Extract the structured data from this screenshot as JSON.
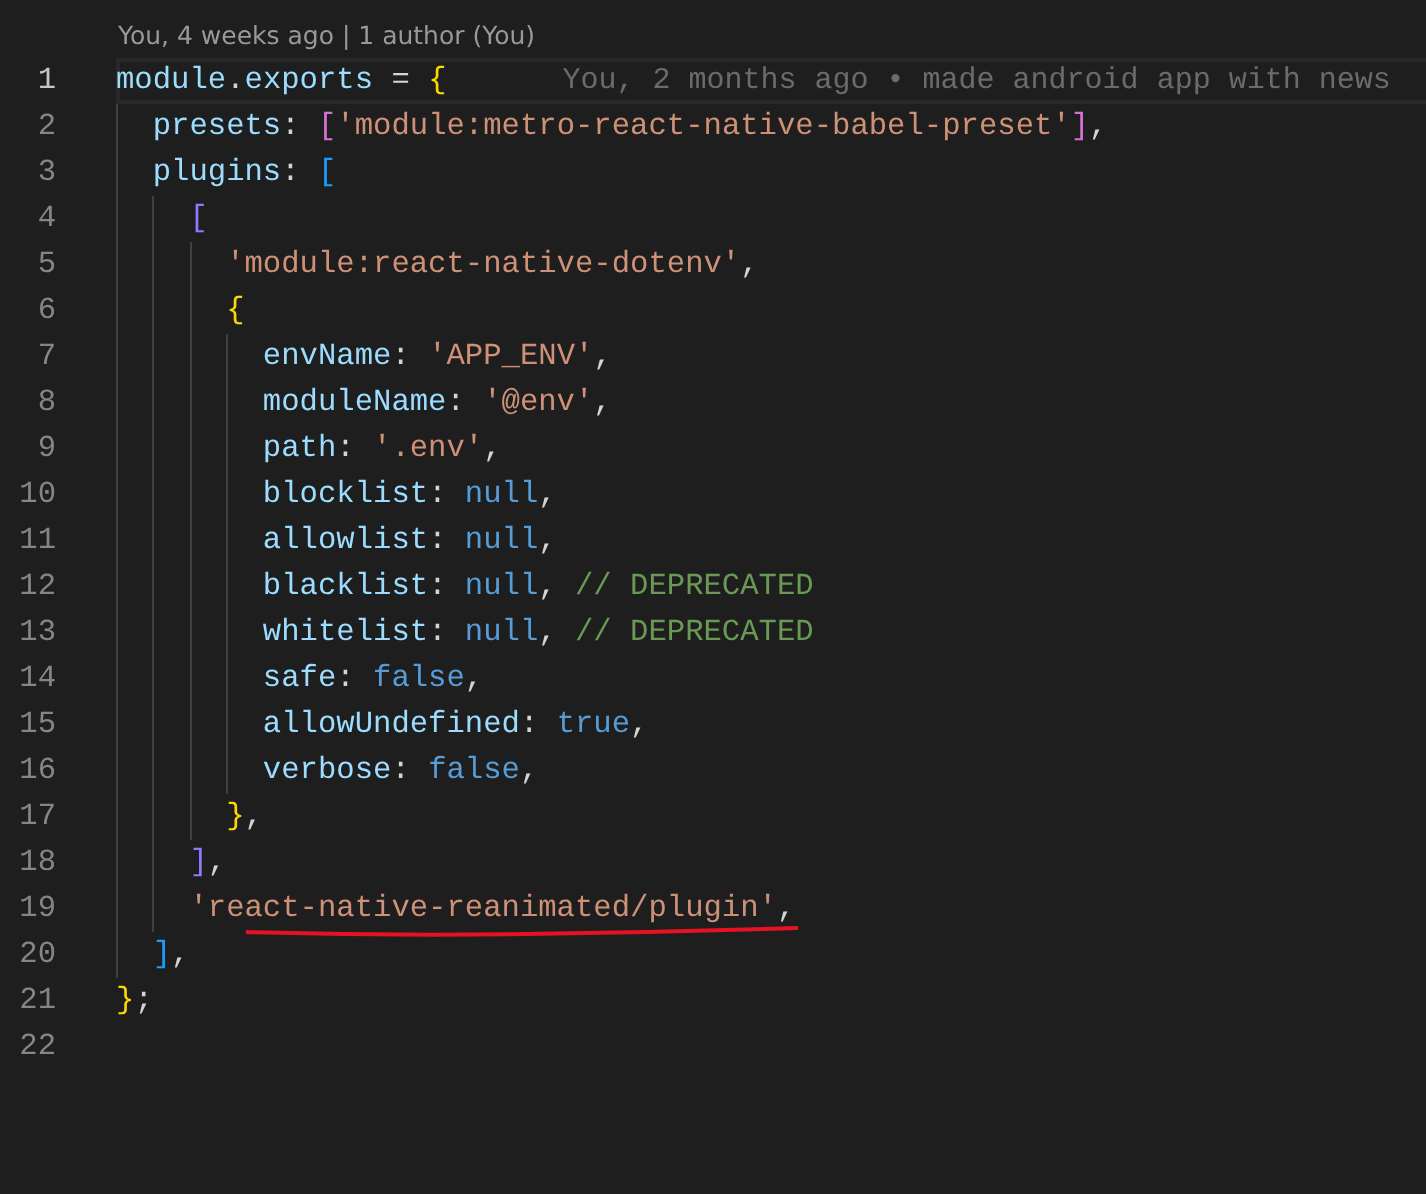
{
  "codelens": "You, 4 weeks ago | 1 author (You)",
  "lines": [
    {
      "number": "1",
      "current": true,
      "underlined": false,
      "blame": "You, 2 months ago • made android app with news",
      "tokens": [
        {
          "text": "module",
          "kind": "prop"
        },
        {
          "text": ".",
          "kind": "plain"
        },
        {
          "text": "exports",
          "kind": "prop"
        },
        {
          "text": " = ",
          "kind": "plain"
        },
        {
          "text": "{",
          "kind": "bracket1"
        }
      ]
    },
    {
      "number": "2",
      "current": false,
      "underlined": false,
      "tokens": [
        {
          "text": "  presets",
          "kind": "prop"
        },
        {
          "text": ": ",
          "kind": "plain"
        },
        {
          "text": "[",
          "kind": "bracket2"
        },
        {
          "text": "'module:metro-react-native-babel-preset'",
          "kind": "string"
        },
        {
          "text": "]",
          "kind": "bracket2"
        },
        {
          "text": ",",
          "kind": "plain"
        }
      ]
    },
    {
      "number": "3",
      "current": false,
      "underlined": false,
      "tokens": [
        {
          "text": "  plugins",
          "kind": "prop"
        },
        {
          "text": ": ",
          "kind": "plain"
        },
        {
          "text": "[",
          "kind": "bracket3"
        }
      ]
    },
    {
      "number": "4",
      "current": false,
      "underlined": false,
      "tokens": [
        {
          "text": "    [",
          "kind": "bracket4"
        }
      ]
    },
    {
      "number": "5",
      "current": false,
      "underlined": false,
      "tokens": [
        {
          "text": "      'module:react-native-dotenv'",
          "kind": "string"
        },
        {
          "text": ",",
          "kind": "plain"
        }
      ]
    },
    {
      "number": "6",
      "current": false,
      "underlined": false,
      "tokens": [
        {
          "text": "      {",
          "kind": "bracket1"
        }
      ]
    },
    {
      "number": "7",
      "current": false,
      "underlined": false,
      "tokens": [
        {
          "text": "        envName",
          "kind": "prop"
        },
        {
          "text": ": ",
          "kind": "plain"
        },
        {
          "text": "'APP_ENV'",
          "kind": "string"
        },
        {
          "text": ",",
          "kind": "plain"
        }
      ]
    },
    {
      "number": "8",
      "current": false,
      "underlined": false,
      "tokens": [
        {
          "text": "        moduleName",
          "kind": "prop"
        },
        {
          "text": ": ",
          "kind": "plain"
        },
        {
          "text": "'@env'",
          "kind": "string"
        },
        {
          "text": ",",
          "kind": "plain"
        }
      ]
    },
    {
      "number": "9",
      "current": false,
      "underlined": false,
      "tokens": [
        {
          "text": "        path",
          "kind": "prop"
        },
        {
          "text": ": ",
          "kind": "plain"
        },
        {
          "text": "'.env'",
          "kind": "string"
        },
        {
          "text": ",",
          "kind": "plain"
        }
      ]
    },
    {
      "number": "10",
      "current": false,
      "underlined": false,
      "tokens": [
        {
          "text": "        blocklist",
          "kind": "prop"
        },
        {
          "text": ": ",
          "kind": "plain"
        },
        {
          "text": "null",
          "kind": "constant"
        },
        {
          "text": ",",
          "kind": "plain"
        }
      ]
    },
    {
      "number": "11",
      "current": false,
      "underlined": false,
      "tokens": [
        {
          "text": "        allowlist",
          "kind": "prop"
        },
        {
          "text": ": ",
          "kind": "plain"
        },
        {
          "text": "null",
          "kind": "constant"
        },
        {
          "text": ",",
          "kind": "plain"
        }
      ]
    },
    {
      "number": "12",
      "current": false,
      "underlined": false,
      "tokens": [
        {
          "text": "        blacklist",
          "kind": "prop"
        },
        {
          "text": ": ",
          "kind": "plain"
        },
        {
          "text": "null",
          "kind": "constant"
        },
        {
          "text": ", ",
          "kind": "plain"
        },
        {
          "text": "// DEPRECATED",
          "kind": "comment"
        }
      ]
    },
    {
      "number": "13",
      "current": false,
      "underlined": false,
      "tokens": [
        {
          "text": "        whitelist",
          "kind": "prop"
        },
        {
          "text": ": ",
          "kind": "plain"
        },
        {
          "text": "null",
          "kind": "constant"
        },
        {
          "text": ", ",
          "kind": "plain"
        },
        {
          "text": "// DEPRECATED",
          "kind": "comment"
        }
      ]
    },
    {
      "number": "14",
      "current": false,
      "underlined": false,
      "tokens": [
        {
          "text": "        safe",
          "kind": "prop"
        },
        {
          "text": ": ",
          "kind": "plain"
        },
        {
          "text": "false",
          "kind": "constant"
        },
        {
          "text": ",",
          "kind": "plain"
        }
      ]
    },
    {
      "number": "15",
      "current": false,
      "underlined": false,
      "tokens": [
        {
          "text": "        allowUndefined",
          "kind": "prop"
        },
        {
          "text": ": ",
          "kind": "plain"
        },
        {
          "text": "true",
          "kind": "constant"
        },
        {
          "text": ",",
          "kind": "plain"
        }
      ]
    },
    {
      "number": "16",
      "current": false,
      "underlined": false,
      "tokens": [
        {
          "text": "        verbose",
          "kind": "prop"
        },
        {
          "text": ": ",
          "kind": "plain"
        },
        {
          "text": "false",
          "kind": "constant"
        },
        {
          "text": ",",
          "kind": "plain"
        }
      ]
    },
    {
      "number": "17",
      "current": false,
      "underlined": false,
      "tokens": [
        {
          "text": "      }",
          "kind": "bracket1"
        },
        {
          "text": ",",
          "kind": "plain"
        }
      ]
    },
    {
      "number": "18",
      "current": false,
      "underlined": false,
      "tokens": [
        {
          "text": "    ]",
          "kind": "bracket4"
        },
        {
          "text": ",",
          "kind": "plain"
        }
      ]
    },
    {
      "number": "19",
      "current": false,
      "underlined": true,
      "tokens": [
        {
          "text": "    'react-native-reanimated/plugin'",
          "kind": "string"
        },
        {
          "text": ",",
          "kind": "plain"
        }
      ]
    },
    {
      "number": "20",
      "current": false,
      "underlined": false,
      "tokens": [
        {
          "text": "  ]",
          "kind": "bracket3"
        },
        {
          "text": ",",
          "kind": "plain"
        }
      ]
    },
    {
      "number": "21",
      "current": false,
      "underlined": false,
      "tokens": [
        {
          "text": "}",
          "kind": "bracket1"
        },
        {
          "text": ";",
          "kind": "plain"
        }
      ]
    },
    {
      "number": "22",
      "current": false,
      "underlined": false
    }
  ]
}
